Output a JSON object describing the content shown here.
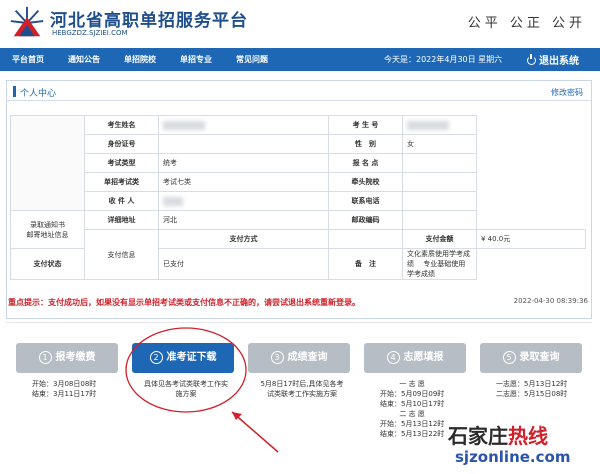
{
  "header": {
    "title": "河北省高职单招服务平台",
    "domain": "HEBGZDZ.SJZIEI.COM",
    "slogan": "公平 公正 公开"
  },
  "nav": {
    "items": [
      "平台首页",
      "通知公告",
      "单招院校",
      "单招专业",
      "常见问题"
    ],
    "date": "今天是：2022年4月30日 星期六",
    "logout": "退出系统"
  },
  "card": {
    "title": "个人中心",
    "change_password": "修改密码"
  },
  "info": {
    "name_label": "考生姓名",
    "exam_no_label": "考 生 号",
    "id_label": "身份证号",
    "gender_label": "性　别",
    "gender": "女",
    "exam_type_label": "考试类型",
    "exam_type": "统考",
    "signup_label": "报 名 点",
    "category_label": "单招考试类",
    "category": "考试七类",
    "lead_school_label": "牵头院校",
    "recipient_label": "收 件 人",
    "phone_label": "联系电话",
    "mail_section": "录取通知书\n邮寄地址信息",
    "address_label": "详细地址",
    "address_partial": "河北",
    "postcode_label": "邮政编码",
    "pay_section": "支付信息",
    "pay_method_label": "支付方式",
    "pay_amount_label": "支付金额",
    "pay_amount": "¥ 40.0元",
    "pay_status_label": "支付状态",
    "pay_status": "已支付",
    "remark_label": "备　注",
    "remark": "文化素质使用学考成绩　 专业基础使用学考成绩"
  },
  "notice": "重点提示：支付成功后，如果没有显示单招考试类或支付信息不正确的，请尝试退出系统重新登录。",
  "timestamp": "2022-04-30 08:39:36",
  "steps": [
    {
      "num": "1",
      "label": "报考缴费",
      "lines": [
        "开始：3月08日08时",
        "结束：3月11日17时"
      ]
    },
    {
      "num": "2",
      "label": "准考证下载",
      "lines": [
        "具体见各考试类联考工作实",
        "施方案"
      ]
    },
    {
      "num": "3",
      "label": "成绩查询",
      "lines": [
        "5月8日17时后,具体见各考",
        "试类联考工作实施方案"
      ]
    },
    {
      "num": "4",
      "label": "志愿填报",
      "lines": [
        "一 志 愿",
        "开始：5月09日09时",
        "结束：5月10日17时",
        "二 志 愿",
        "开始：5月13日12时",
        "结束：5月13日22时"
      ]
    },
    {
      "num": "5",
      "label": "录取查询",
      "lines": [
        "一志愿：5月13日12时",
        "二志愿：5月15日08时"
      ]
    }
  ],
  "watermark": {
    "left": "石家庄",
    "right": "热线",
    "url": "sjzonline.com"
  },
  "colors": {
    "brand": "#1e67b5",
    "alert": "#d0202a",
    "paid": "#2e9b2e"
  }
}
